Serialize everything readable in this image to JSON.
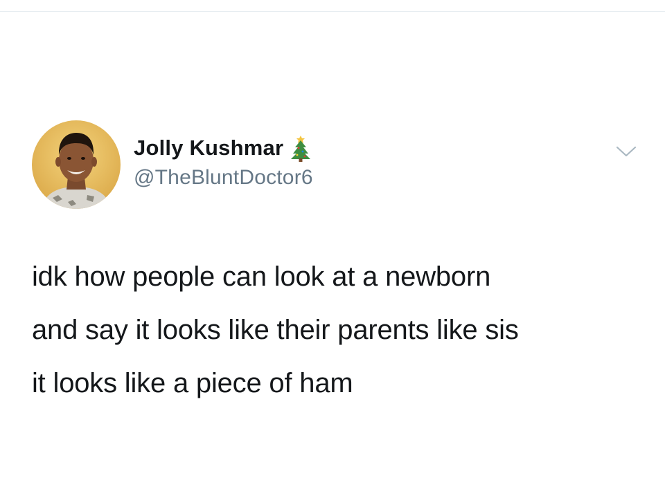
{
  "tweet": {
    "author": {
      "display_name": "Jolly Kushmar",
      "handle": "@TheBluntDoctor6",
      "name_emoji_icon": "christmas-tree-icon",
      "avatar": "profile-photo"
    },
    "menu_icon": "chevron-down-icon",
    "text_lines": [
      "idk how people can look at a newborn",
      "and say it looks like their parents like sis",
      "it looks like a piece of ham"
    ]
  },
  "colors": {
    "text_primary": "#14171a",
    "text_secondary": "#657786",
    "chevron": "#aab8c2",
    "divider": "#e6ecf0",
    "background": "#ffffff"
  }
}
